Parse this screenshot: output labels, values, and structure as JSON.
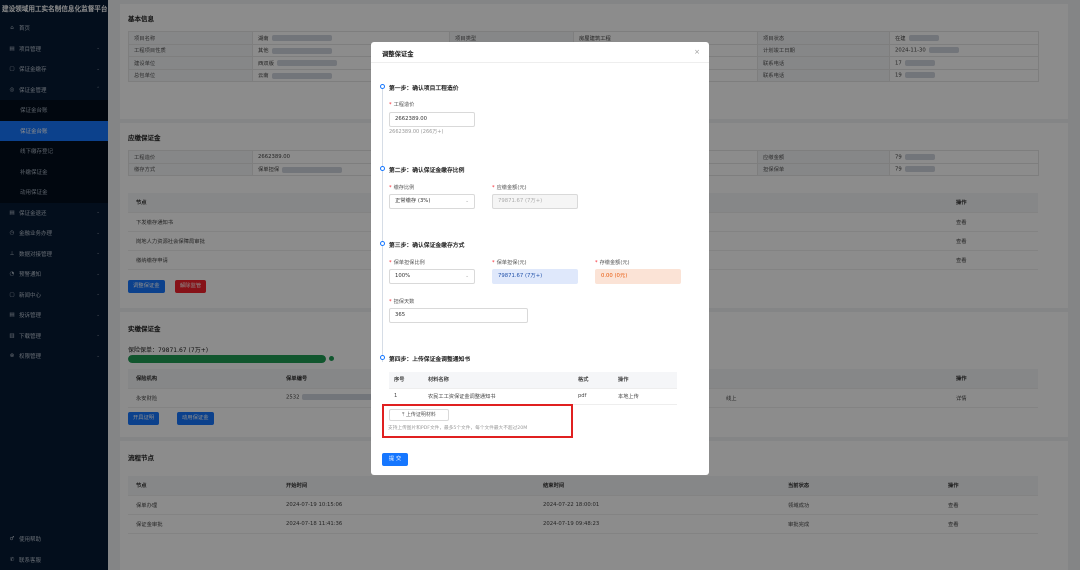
{
  "app": {
    "title": "建设领域用工实名制信息化监督平台"
  },
  "sidebar": {
    "items": [
      {
        "icon": "⌂",
        "label": "首页",
        "arrow": "",
        "type": "top"
      },
      {
        "icon": "▤",
        "label": "项目管理",
        "arrow": "⌄",
        "type": "top"
      },
      {
        "icon": "▢",
        "label": "保证金缴存",
        "arrow": "⌄",
        "type": "top"
      },
      {
        "icon": "◎",
        "label": "保证金管理",
        "arrow": "⌃",
        "type": "top"
      },
      {
        "icon": "",
        "label": "保证金台账",
        "arrow": "",
        "type": "sub"
      },
      {
        "icon": "",
        "label": "保证金台账",
        "arrow": "",
        "type": "active"
      },
      {
        "icon": "",
        "label": "线下缴存登记",
        "arrow": "",
        "type": "sub"
      },
      {
        "icon": "",
        "label": "补缴保证金",
        "arrow": "",
        "type": "sub"
      },
      {
        "icon": "",
        "label": "动用保证金",
        "arrow": "",
        "type": "sub"
      },
      {
        "icon": "▤",
        "label": "保证金退还",
        "arrow": "⌄",
        "type": "top"
      },
      {
        "icon": "◷",
        "label": "金融业务办理",
        "arrow": "⌄",
        "type": "top"
      },
      {
        "icon": "⊥",
        "label": "数据对接管理",
        "arrow": "⌄",
        "type": "top"
      },
      {
        "icon": "◔",
        "label": "预警通知",
        "arrow": "⌄",
        "type": "top"
      },
      {
        "icon": "▢",
        "label": "新闻中心",
        "arrow": "⌄",
        "type": "top"
      },
      {
        "icon": "▤",
        "label": "投诉管理",
        "arrow": "⌄",
        "type": "top"
      },
      {
        "icon": "▥",
        "label": "下载管理",
        "arrow": "⌄",
        "type": "top"
      },
      {
        "icon": "⊗",
        "label": "权限管理",
        "arrow": "⌄",
        "type": "top"
      }
    ],
    "bottom": [
      {
        "icon": "♂",
        "label": "使用帮助"
      },
      {
        "icon": "✆",
        "label": "联系客服"
      }
    ]
  },
  "basic_info": {
    "title": "基本信息",
    "rows": [
      [
        "项目名称",
        "湖南",
        "项目类型",
        "房屋建筑工程",
        "项目状态",
        "在建"
      ],
      [
        "工程项目性质",
        "其他",
        "",
        "",
        "计划竣工日期",
        "2024-11-30"
      ],
      [
        "建设单位",
        "西双版",
        "",
        "",
        "联系电话",
        "17"
      ],
      [
        "总包单位",
        "云南",
        "",
        "",
        "联系电话",
        "19"
      ]
    ]
  },
  "payable": {
    "title": "应缴保证金",
    "rows": [
      [
        "工程造价",
        "2662389.00",
        "",
        "",
        "应缴金额",
        "79"
      ],
      [
        "缴存方式",
        "保单担保",
        "",
        "",
        "担保保单",
        "79"
      ]
    ],
    "flow_header": [
      "节点",
      "",
      "操作"
    ],
    "flow_rows": [
      [
        "下发缴存通知书",
        "查看"
      ],
      [
        "岗地人力资源社会保障局审批",
        "查看"
      ],
      [
        "缴纳缴存申请",
        "查看"
      ]
    ],
    "btn_adjust": "调整保证金",
    "btn_release": "解除监管"
  },
  "actual": {
    "title": "实缴保证金",
    "guarantee_label": "保险保单：79871.67 (7万+)",
    "progress": 1.0,
    "header": [
      "保险机构",
      "保单编号",
      "",
      "",
      "",
      "",
      "操作"
    ],
    "row": [
      "永安财险",
      "2532",
      "",
      "",
      "线上",
      "详情"
    ],
    "btn_cert": "开具证明",
    "btn_use": "动用保证金"
  },
  "process": {
    "title": "流程节点",
    "header": [
      "节点",
      "开始时间",
      "结束时间",
      "当前状态",
      "操作"
    ],
    "rows": [
      [
        "保单办理",
        "2024-07-19 10:15:06",
        "2024-07-22 18:00:01",
        "领域成功",
        "查看"
      ],
      [
        "保证金审批",
        "2024-07-18 11:41:36",
        "2024-07-19 09:48:23",
        "审批完成",
        "查看"
      ]
    ]
  },
  "modal": {
    "title": "调整保证金",
    "close": "×",
    "step1": {
      "title": "第一步：确认项目工程造价",
      "label": "工程造价",
      "value": "2662389.00",
      "hint": "2662389.00 (266万+)"
    },
    "step2": {
      "title": "第二步：确认保证金缴存比例",
      "ratio_label": "缴存比例",
      "ratio_value": "正常缴存 (3%)",
      "amount_label": "应缴金额(元)",
      "amount_value": "79871.67 (7万+)"
    },
    "step3": {
      "title": "第三步：确认保证金缴存方式",
      "pct_label": "保单担保比例",
      "pct_value": "100%",
      "guar_label": "保单担保(元)",
      "guar_value": "79871.67 (7万+)",
      "deposit_label": "存缴金额(元)",
      "deposit_value": "0.00 (0元)",
      "days_label": "担保天数",
      "days_value": "365"
    },
    "step4": {
      "title": "第四步：上传保证金调整通知书",
      "header": [
        "序号",
        "材料名称",
        "格式",
        "操作"
      ],
      "rows": [
        [
          "1",
          "农民工工资保证金调整通知书",
          "pdf",
          "本地上传"
        ]
      ],
      "upload_btn": "上传证明材料",
      "upload_hint": "支持上传图片和PDF文件，最多5个文件，每个文件最大不超过20M"
    },
    "submit": "提 交"
  }
}
